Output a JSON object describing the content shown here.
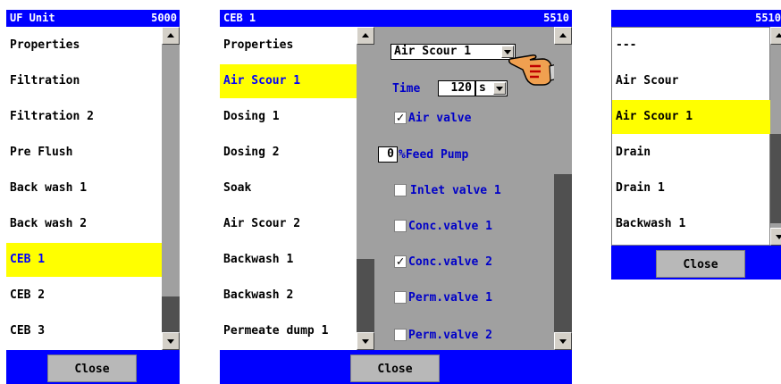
{
  "panel1": {
    "title": "UF Unit",
    "number": "5000",
    "items": [
      "Properties",
      "Filtration",
      "Filtration 2",
      "Pre Flush",
      "Back wash 1",
      "Back wash 2",
      "CEB 1",
      "CEB 2",
      "CEB 3"
    ],
    "selected_index": 6,
    "close_label": "Close"
  },
  "panel2": {
    "title": "CEB 1",
    "number": "5510",
    "items": [
      "Properties",
      "Air Scour 1",
      "Dosing 1",
      "Dosing 2",
      "Soak",
      "Air Scour 2",
      "Backwash 1",
      "Backwash 2",
      "Permeate dump 1"
    ],
    "selected_index": 1,
    "close_label": "Close",
    "props": {
      "step_select": "Air Scour 1",
      "time_label": "Time",
      "time_value": "120",
      "time_unit": "s",
      "air_valve": "Air valve",
      "feed_pump_value": "0",
      "feed_pump_label": "%Feed Pump",
      "inlet_valve": "Inlet valve 1",
      "conc_valve_1": "Conc.valve 1",
      "conc_valve_2": "Conc.valve 2",
      "perm_valve_1": "Perm.valve 1",
      "perm_valve_2": "Perm.valve 2",
      "checked_mark": "✓"
    }
  },
  "panel3": {
    "number": "5510",
    "items": [
      "---",
      "Air Scour",
      "Air Scour 1",
      "Drain",
      "Drain 1",
      "Backwash 1"
    ],
    "selected_index": 2,
    "close_label": "Close"
  },
  "colors": {
    "title_blue": "#0000ff",
    "highlight_yellow": "#ffff00",
    "panel_gray": "#a0a0a0",
    "label_blue": "#0000c8"
  },
  "icons": [
    "scroll-up-icon",
    "scroll-down-icon",
    "dropdown-arrow-icon",
    "pointing-hand-icon",
    "checkmark-icon"
  ]
}
